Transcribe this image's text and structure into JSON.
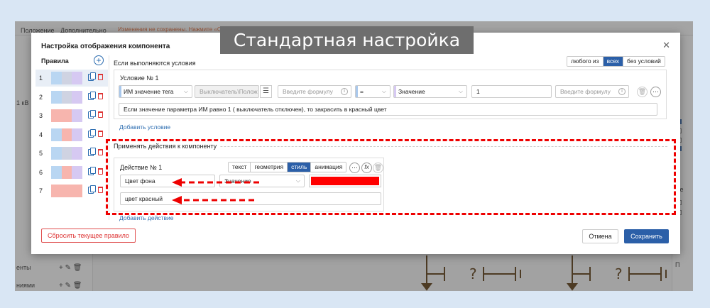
{
  "app": {
    "menu": [
      "Положение",
      "Дополнительно"
    ],
    "unsaved_notice": "Изменения не сохранены. Нажмите «Сохранить»",
    "left_panel": {
      "top_label": "1 кВ",
      "rows": [
        {
          "label": "енты"
        },
        {
          "label": "ниями"
        }
      ]
    },
    "right_panel": {
      "labels": [
        "Не",
        "У",
        "П"
      ]
    },
    "diagram_symbols": [
      "?",
      "?"
    ]
  },
  "banner": {
    "title": "Стандартная настройка"
  },
  "modal": {
    "title": "Настройка отображения компонента",
    "rules_header": "Правила",
    "rules": [
      {
        "num": "1",
        "colors": [
          "#b9d6f2",
          "#cfd3e2",
          "#d6c9f2"
        ],
        "active": true
      },
      {
        "num": "2",
        "colors": [
          "#b9d6f2",
          "#cfd3e2",
          "#d6c9f2"
        ],
        "active": false
      },
      {
        "num": "3",
        "colors": [
          "#f7b5ae",
          "#f7b5ae",
          "#d6c9f2"
        ],
        "active": false
      },
      {
        "num": "4",
        "colors": [
          "#b9d6f2",
          "#f7b5ae",
          "#d6c9f2"
        ],
        "active": false
      },
      {
        "num": "5",
        "colors": [
          "#b9d6f2",
          "#cfd3e2",
          "#d6c9f2"
        ],
        "active": false
      },
      {
        "num": "6",
        "colors": [
          "#b9d6f2",
          "#f7b5ae",
          "#d6c9f2"
        ],
        "active": false
      },
      {
        "num": "7",
        "colors": [
          "#f7b5ae",
          "#f7b5ae",
          "#f7b5ae"
        ],
        "active": false
      }
    ],
    "conditions": {
      "header": "Если выполняются условия",
      "mode_options": [
        "любого из",
        "всех",
        "без условий"
      ],
      "mode_selected": "всех",
      "condition": {
        "title": "Условие № 1",
        "tag_select": "ИМ значение тега",
        "source_select": "Выключатель\\Полож",
        "formula_placeholder_1": "Введите формулу",
        "operator": "=",
        "value_type": "Значение",
        "value": "1",
        "formula_placeholder_2": "Введите формулу",
        "description": "Если значение параметра ИМ равно 1 ( выключатель отключен), то закрасить в красный цвет"
      },
      "add_condition": "Добавить условие"
    },
    "actions": {
      "header": "Применять действия к компоненту",
      "action": {
        "title": "Действие № 1",
        "tabs": [
          "текст",
          "геометрия",
          "стиль",
          "анимация"
        ],
        "tab_selected": "стиль",
        "property": "Цвет фона",
        "value_type": "Значение",
        "color": "#ff0000",
        "description": "цвет красный"
      },
      "add_action": "Добавить действие"
    },
    "reset_label": "Сбросить текущее правило",
    "cancel_label": "Отмена",
    "save_label": "Сохранить"
  },
  "colors": {
    "accent": "#2b5fa8",
    "annotation": "#e00000",
    "danger": "#d33333"
  }
}
